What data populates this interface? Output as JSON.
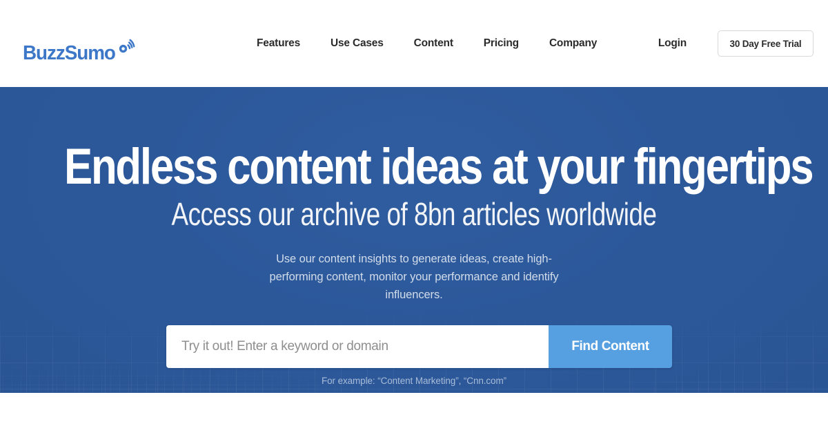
{
  "brand": {
    "name": "BuzzSumo",
    "logo_icon": "wifi-signal-icon",
    "accent_color": "#3d78c8"
  },
  "nav": {
    "links": [
      {
        "label": "Features"
      },
      {
        "label": "Use Cases"
      },
      {
        "label": "Content"
      },
      {
        "label": "Pricing"
      },
      {
        "label": "Company"
      }
    ],
    "login_label": "Login",
    "trial_button_label": "30 Day Free Trial"
  },
  "hero": {
    "headline": "Endless content ideas at your fingertips",
    "subheadline": "Access our archive of 8bn articles worldwide",
    "paragraph": "Use our content insights to generate ideas, create high-performing content, monitor your performance and identify influencers.",
    "background_color": "#2c589a",
    "search": {
      "placeholder": "Try it out! Enter a keyword or domain",
      "value": "",
      "button_label": "Find Content",
      "button_color": "#56a0e2"
    },
    "example_text": "For example: “Content Marketing”, “Cnn.com”"
  }
}
